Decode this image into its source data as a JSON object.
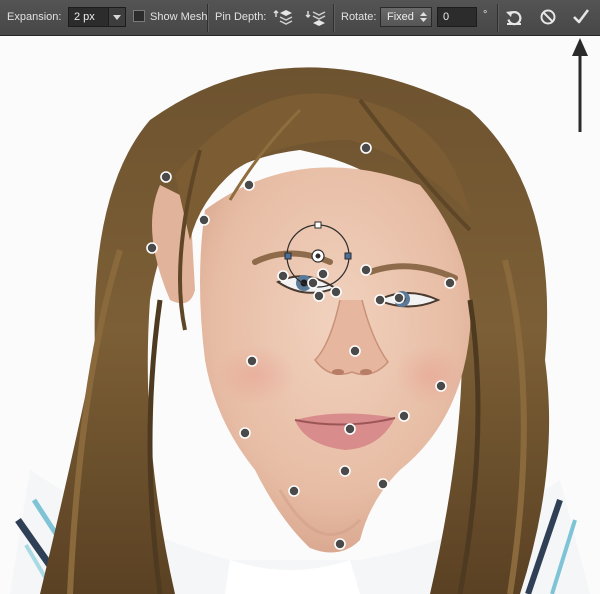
{
  "toolbar": {
    "expansion_label": "Expansion:",
    "expansion_value": "2 px",
    "show_mesh_label": "Show Mesh",
    "show_mesh_checked": false,
    "pin_depth_label": "Pin Depth:",
    "rotate_label": "Rotate:",
    "rotate_mode": "Fixed",
    "rotate_angle": "0",
    "degree_symbol": "°"
  },
  "icons": {
    "pin_depth_front": "bring-pin-forward-icon",
    "pin_depth_back": "send-pin-backward-icon",
    "reset": "reset-icon",
    "cancel": "cancel-icon",
    "commit": "commit-checkmark-icon",
    "annotation": "annotation-arrow"
  },
  "colors": {
    "toolbar_bg": "#4a4a4a",
    "field_bg": "#2c2c2c",
    "text": "#e2e2e2",
    "pin_fill": "#4a4a4a",
    "pin_ring": "#ffffff",
    "rotation_handle": "#4a6f9a"
  },
  "pins": {
    "count": 25,
    "selected_count": 1
  }
}
